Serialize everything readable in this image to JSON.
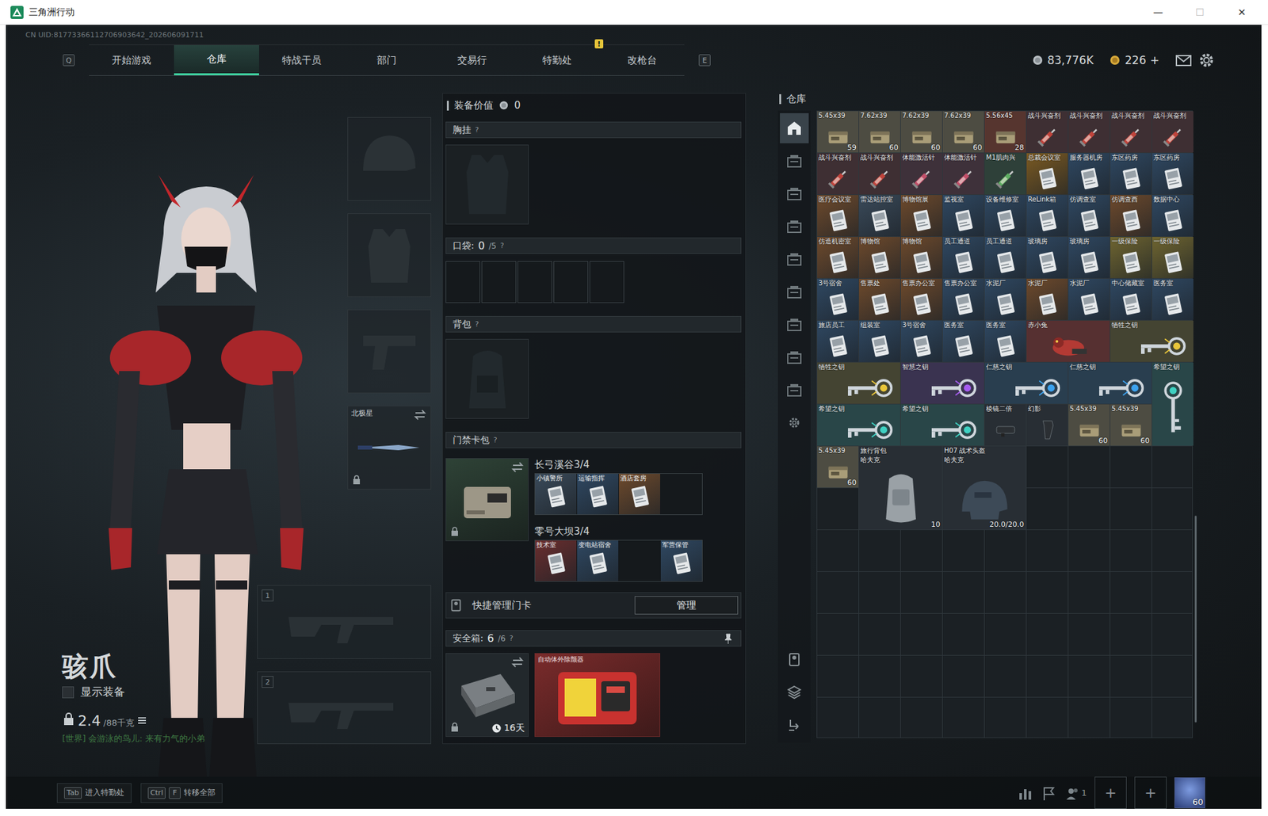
{
  "window": {
    "title": "三角洲行动",
    "controls": [
      {
        "glyph": "—",
        "disabled": false
      },
      {
        "glyph": "☐",
        "disabled": true
      },
      {
        "glyph": "✕",
        "disabled": false
      }
    ]
  },
  "uid": "CN UID:81773366112706903642_202606091711",
  "nav": {
    "prev_key": "Q",
    "next_key": "E",
    "tabs": [
      {
        "label": "开始游戏",
        "selected": false
      },
      {
        "label": "仓库",
        "selected": true
      },
      {
        "label": "特战干员",
        "selected": false
      },
      {
        "label": "部门",
        "selected": false
      },
      {
        "label": "交易行",
        "selected": false
      },
      {
        "label": "特勤处",
        "selected": false,
        "badge": "!"
      },
      {
        "label": "改枪台",
        "selected": false
      }
    ]
  },
  "currency": {
    "coins": "83,776K",
    "tickets": "226",
    "add": "+"
  },
  "operator": {
    "name": "骇爪",
    "show_equipment": {
      "label": "显示装备",
      "checked": false
    },
    "weight": "2.4",
    "weight_max": "/88千克",
    "chat": {
      "channel": "[世界]",
      "message": "会游泳的鸟儿: 来有力气的小弟"
    }
  },
  "gear_slots": [
    {
      "kind": "helmet",
      "locked": false
    },
    {
      "kind": "armor",
      "locked": false
    },
    {
      "kind": "pistol",
      "locked": false
    },
    {
      "kind": "melee",
      "label": "北极星",
      "locked": true
    }
  ],
  "weapon_slots": [
    {
      "number": "1"
    },
    {
      "number": "2"
    }
  ],
  "loadout": {
    "value": {
      "label": "装备价值",
      "amount": "0"
    },
    "chest": {
      "label": "胸挂",
      "help": "?"
    },
    "pockets": {
      "label": "口袋:",
      "count": "0",
      "capacity": "/5",
      "help": "?",
      "slots": [
        {
          "filled": false
        },
        {
          "filled": false
        },
        {
          "filled": false
        },
        {
          "filled": false
        },
        {
          "filled": false
        }
      ]
    },
    "backpack": {
      "label": "背包",
      "help": "?"
    },
    "keycards": {
      "label": "门禁卡包",
      "help": "?",
      "maps": [
        {
          "name": "长弓溪谷",
          "count": "3/4",
          "cards": [
            {
              "label": "小镇警所",
              "filled": true,
              "color": "#3a4a5a"
            },
            {
              "label": "运输指挥",
              "filled": true,
              "color": "#2f4862"
            },
            {
              "label": "酒店套房",
              "filled": true,
              "color": "#6e4a2c"
            },
            {
              "filled": false
            }
          ]
        },
        {
          "name": "零号大坝",
          "count": "3/4",
          "cards": [
            {
              "label": "技术室",
              "filled": true,
              "color": "#6a2e2e"
            },
            {
              "label": "变电站宿舍",
              "filled": true,
              "color": "#2f4862"
            },
            {
              "filled": false
            },
            {
              "label": "军营保管",
              "filled": true,
              "color": "#2f4862"
            }
          ]
        }
      ]
    },
    "quick_manage": {
      "label": "快捷管理门卡",
      "button": "管理"
    },
    "safe": {
      "label": "安全箱:",
      "count": "6",
      "capacity": "/6",
      "help": "?",
      "timer": "16天",
      "item": "自动体外除颤器"
    }
  },
  "warehouse": {
    "title": "仓库",
    "tabs": [
      {
        "selected": true
      },
      {
        "selected": false
      },
      {
        "selected": false
      },
      {
        "selected": false
      },
      {
        "selected": false
      },
      {
        "selected": false
      },
      {
        "selected": false
      },
      {
        "selected": false
      },
      {
        "selected": false
      }
    ],
    "items": [
      {
        "name": "5.45x39",
        "count": "59",
        "kind": "ammo",
        "color": "#4d4c42"
      },
      {
        "name": "7.62x39",
        "count": "60",
        "kind": "ammo",
        "color": "#4d4c42"
      },
      {
        "name": "7.62x39",
        "count": "60",
        "kind": "ammo",
        "color": "#4d4c42"
      },
      {
        "name": "7.62x39",
        "count": "60",
        "kind": "ammo",
        "color": "#4d4c42"
      },
      {
        "name": "5.56x45",
        "count": "28",
        "kind": "ammo",
        "color": "#56352f"
      },
      {
        "name": "战斗兴奋剂",
        "kind": "stim",
        "color": "#c0443c"
      },
      {
        "name": "战斗兴奋剂",
        "kind": "stim",
        "color": "#c0443c"
      },
      {
        "name": "战斗兴奋剂",
        "kind": "stim",
        "color": "#c0443c"
      },
      {
        "name": "战斗兴奋剂",
        "kind": "stim",
        "color": "#c0443c"
      },
      {
        "name": "战斗兴奋剂",
        "kind": "stim",
        "color": "#c0443c"
      },
      {
        "name": "战斗兴奋剂",
        "kind": "stim",
        "color": "#c0443c"
      },
      {
        "name": "体能激活针",
        "kind": "stim",
        "color": "#c2506a"
      },
      {
        "name": "体能激活针",
        "kind": "stim",
        "color": "#c2506a"
      },
      {
        "name": "M1肌肉兴",
        "kind": "stim",
        "color": "#5fae62"
      },
      {
        "name": "总裁会议室",
        "kind": "card",
        "color": "#7b5a22"
      },
      {
        "name": "服务器机房",
        "kind": "card",
        "color": "#2f4862"
      },
      {
        "name": "东区药房",
        "kind": "card",
        "color": "#2f4862"
      },
      {
        "name": "东区药房",
        "kind": "card",
        "color": "#2f4862"
      },
      {
        "name": "医疗会议室",
        "kind": "card",
        "color": "#6e4a2c"
      },
      {
        "name": "雷达站控室",
        "kind": "card",
        "color": "#3a4a5a"
      },
      {
        "name": "博物馆展",
        "kind": "card",
        "color": "#6e4a2c"
      },
      {
        "name": "监视室",
        "kind": "card",
        "color": "#2f4862"
      },
      {
        "name": "设备维修室",
        "kind": "card",
        "color": "#2f4862"
      },
      {
        "name": "ReLink箱",
        "kind": "card",
        "color": "#2f4862"
      },
      {
        "name": "仿调查室",
        "kind": "card",
        "color": "#2f4862"
      },
      {
        "name": "仿调查西",
        "kind": "card",
        "color": "#6e4a2c"
      },
      {
        "name": "数据中心",
        "kind": "card",
        "color": "#2f4862"
      },
      {
        "name": "仿造机密室",
        "kind": "card",
        "color": "#6e4a2c"
      },
      {
        "name": "博物馆",
        "kind": "card",
        "color": "#6e4a2c"
      },
      {
        "name": "博物馆",
        "kind": "card",
        "color": "#6e4a2c"
      },
      {
        "name": "员工通道",
        "kind": "card",
        "color": "#2f4862"
      },
      {
        "name": "员工通道",
        "kind": "card",
        "color": "#2f4862"
      },
      {
        "name": "玻璃房",
        "kind": "card",
        "color": "#2f4862"
      },
      {
        "name": "玻璃房",
        "kind": "card",
        "color": "#2f4862"
      },
      {
        "name": "一级保险",
        "kind": "card",
        "color": "#6f6530"
      },
      {
        "name": "一级保险",
        "kind": "card",
        "color": "#6f6530"
      },
      {
        "name": "3号宿舍",
        "kind": "card",
        "color": "#2f4862"
      },
      {
        "name": "售票处",
        "kind": "card",
        "color": "#6e4a2c"
      },
      {
        "name": "售票办公室",
        "kind": "card",
        "color": "#6e4a2c"
      },
      {
        "name": "售票办公室",
        "kind": "card",
        "color": "#2f4862"
      },
      {
        "name": "水泥厂",
        "kind": "card",
        "color": "#2f4862"
      },
      {
        "name": "水泥厂",
        "kind": "card",
        "color": "#6e4a2c"
      },
      {
        "name": "水泥厂",
        "kind": "card",
        "color": "#2f4862"
      },
      {
        "name": "中心储藏室",
        "kind": "card",
        "color": "#2f4862"
      },
      {
        "name": "医务室",
        "kind": "card",
        "color": "#2f4862"
      },
      {
        "name": "旅店员工",
        "kind": "card",
        "color": "#2f4862"
      },
      {
        "name": "组装室",
        "kind": "card",
        "color": "#2f4862"
      },
      {
        "name": "3号宿舍",
        "kind": "card",
        "color": "#2f4862"
      },
      {
        "name": "医务室",
        "kind": "card",
        "color": "#2f4862"
      },
      {
        "name": "医务室",
        "kind": "card",
        "color": "#2f4862"
      },
      {
        "name": "赤小兔",
        "kind": "figure",
        "color": "#b33a34"
      },
      {
        "name": "牺牲之钥",
        "kind": "key",
        "color": "#e8c53a"
      },
      {
        "name": "牺牲之钥",
        "kind": "key",
        "color": "#e8c53a"
      },
      {
        "name": "智慧之钥",
        "kind": "key",
        "color": "#a65cf0"
      },
      {
        "name": "仁慈之钥",
        "kind": "key",
        "color": "#3da2ee"
      },
      {
        "name": "仁慈之钥",
        "kind": "key",
        "color": "#3da2ee"
      },
      {
        "name": "希望之钥",
        "kind": "key-tall",
        "color": "#3fd1c2"
      },
      {
        "name": "希望之钥",
        "kind": "key",
        "color": "#3fd1c2"
      },
      {
        "name": "希望之钥",
        "kind": "key",
        "color": "#3fd1c2"
      },
      {
        "name": "棱镜二倍",
        "kind": "scope",
        "color": "#3a3f44"
      },
      {
        "name": "幻影",
        "kind": "grip",
        "color": "#3a3f44"
      },
      {
        "name": "5.45x39",
        "count": "60",
        "kind": "ammo",
        "color": "#4d4c42"
      },
      {
        "name": "5.45x39",
        "count": "60",
        "kind": "ammo",
        "color": "#4d4c42"
      },
      {
        "name": "5.45x39",
        "count": "60",
        "kind": "ammo",
        "color": "#4d4c42"
      },
      {
        "name": "旅行背包",
        "sub": "哈夫克",
        "count": "10",
        "kind": "bag",
        "color": "#3b4046"
      },
      {
        "name": "H07 战术头盔",
        "sub": "哈夫克",
        "count": "20.0/20.0",
        "kind": "helmet",
        "color": "#3b4046"
      }
    ],
    "scrollbar": {
      "start": 0.64,
      "level": 0.33
    }
  },
  "bottom": {
    "hints": [
      {
        "keys": [
          "Tab"
        ],
        "label": "进入特勤处"
      },
      {
        "keys": [
          "Ctrl",
          "F"
        ],
        "label": "转移全部"
      }
    ],
    "friends": "1",
    "slots": [
      "+",
      "+"
    ],
    "level": "60"
  }
}
